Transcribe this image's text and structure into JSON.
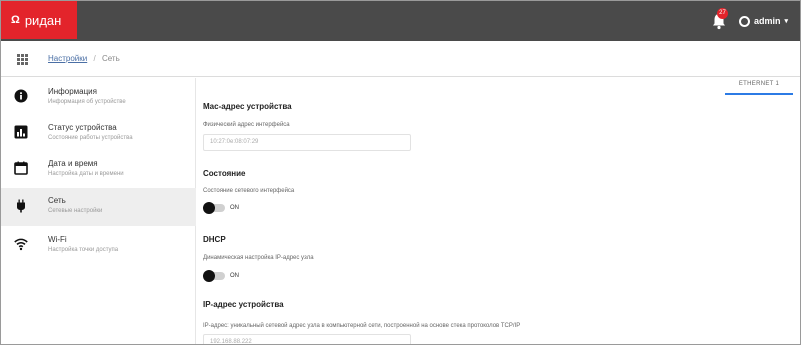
{
  "topbar": {
    "brand_logo": "Ω",
    "brand_name": "ридан",
    "notification_count": "27",
    "user_name": "admin",
    "user_chevron": "▾"
  },
  "breadcrumb": {
    "parent": "Настройки",
    "separator": "/",
    "current": "Сеть"
  },
  "sidebar": {
    "items": [
      {
        "title": "Информация",
        "subtitle": "Информация об устройстве",
        "icon": "info-icon"
      },
      {
        "title": "Статус устройства",
        "subtitle": "Состояние работы устройства",
        "icon": "status-chart-icon"
      },
      {
        "title": "Дата и время",
        "subtitle": "Настройка даты и времени",
        "icon": "calendar-icon"
      },
      {
        "title": "Сеть",
        "subtitle": "Сетевые настройки",
        "icon": "ethernet-plug-icon",
        "active": true
      },
      {
        "title": "Wi-Fi",
        "subtitle": "Настройка точки доступа",
        "icon": "wifi-icon"
      }
    ]
  },
  "main": {
    "tab": "ETHERNET 1",
    "mac": {
      "title": "Mac-адрес устройства",
      "label": "Физический адрес интерфейса",
      "value": "10:27:0e:08:07:29"
    },
    "state": {
      "title": "Состояние",
      "label": "Состояние сетевого интерфейса",
      "toggle": "ON"
    },
    "dhcp": {
      "title": "DHCP",
      "label": "Динамическая настройка IP-адрес узла",
      "toggle": "ON"
    },
    "ip": {
      "title": "IP-адрес устройства",
      "label": "IP-адрес: уникальный сетевой адрес узла в компьютерной сети, построенной на основе стека протоколов TCP/IP",
      "value": "192.168.88.222"
    }
  },
  "colors": {
    "brand": "#e3242b",
    "topbar": "#4a4a4a",
    "accent": "#2c7be5",
    "active_row": "#eeeeee"
  }
}
